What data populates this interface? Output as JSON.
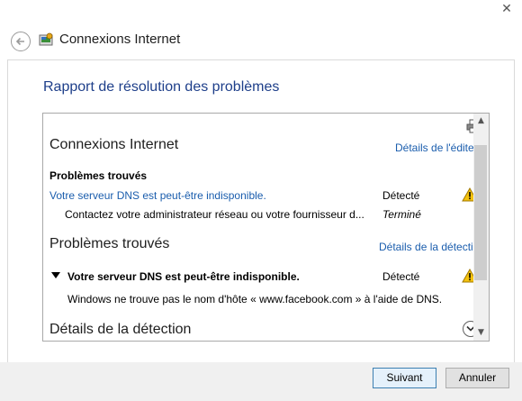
{
  "window": {
    "title": "Connexions Internet",
    "close_glyph": "✕"
  },
  "page": {
    "heading": "Rapport de résolution des problèmes"
  },
  "report": {
    "section1": {
      "title": "Connexions Internet",
      "link": "Détails de l'éditeur",
      "subheading": "Problèmes trouvés",
      "problem_link": "Votre serveur DNS est peut-être indisponible.",
      "problem_status": "Détecté",
      "fix_text": "Contactez votre administrateur réseau ou votre fournisseur d...",
      "fix_status": "Terminé"
    },
    "section2": {
      "title": "Problèmes trouvés",
      "link": "Détails de la détection",
      "problem_title": "Votre serveur DNS est peut-être indisponible.",
      "problem_status": "Détecté",
      "problem_desc": "Windows ne trouve pas le nom d'hôte « www.facebook.com » à l'aide de DNS."
    },
    "section3": {
      "title": "Détails de la détection"
    },
    "icons": {
      "print": "printer-icon",
      "warning": "warning-icon",
      "expand": "chevron-down-icon",
      "collapse": "triangle-down-icon"
    }
  },
  "footer": {
    "next_label": "Suivant",
    "cancel_label": "Annuler"
  },
  "colors": {
    "heading": "#1e3f8a",
    "link": "#1a5dad",
    "warning_fill": "#f4c20d",
    "footer_bg": "#f0f0f0"
  }
}
